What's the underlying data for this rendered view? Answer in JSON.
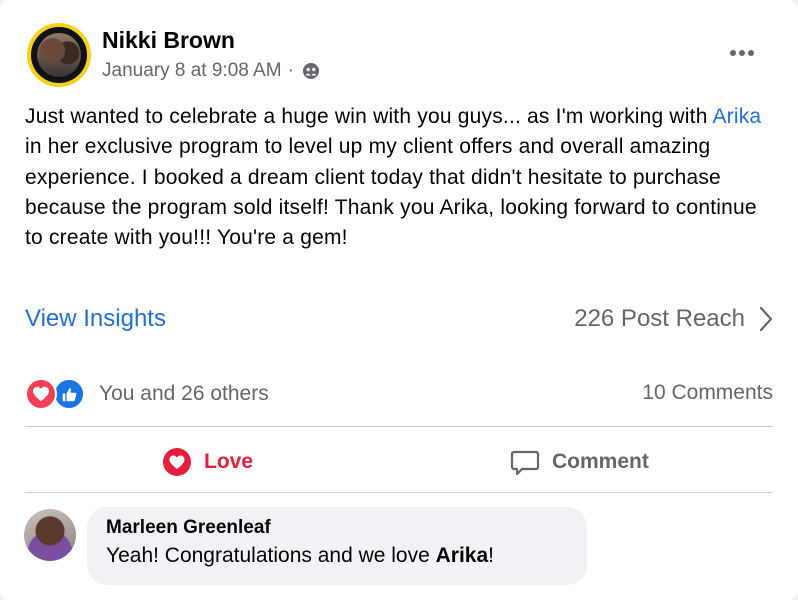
{
  "post": {
    "author": "Nikki Brown",
    "timestamp": "January 8 at 9:08 AM",
    "separator": "·",
    "privacy_icon": "friends-icon",
    "text_before": "Just wanted to celebrate a huge win with you guys... as I'm working with ",
    "mention": "Arika",
    "text_after": " in her exclusive program to level up my client offers and overall amazing experience. I booked a dream client today that didn't hesitate to purchase because the program sold itself! Thank you Arika, looking forward to continue to create with you!!! You're a gem!"
  },
  "insights": {
    "link_label": "View Insights",
    "reach_label": "226 Post Reach"
  },
  "reactions": {
    "summary": "You and 26 others",
    "comments_count": "10 Comments",
    "icons": [
      "love-icon",
      "like-icon"
    ]
  },
  "actions": {
    "love_label": "Love",
    "comment_label": "Comment"
  },
  "comment": {
    "author": "Marleen Greenleaf",
    "text_before": "Yeah! Congratulations and we love ",
    "mention": "Arika",
    "text_after": "!"
  },
  "colors": {
    "link_blue": "#216fdb",
    "love_red": "#e41e3f",
    "like_blue": "#1b74e4",
    "secondary_text": "#65676b"
  }
}
